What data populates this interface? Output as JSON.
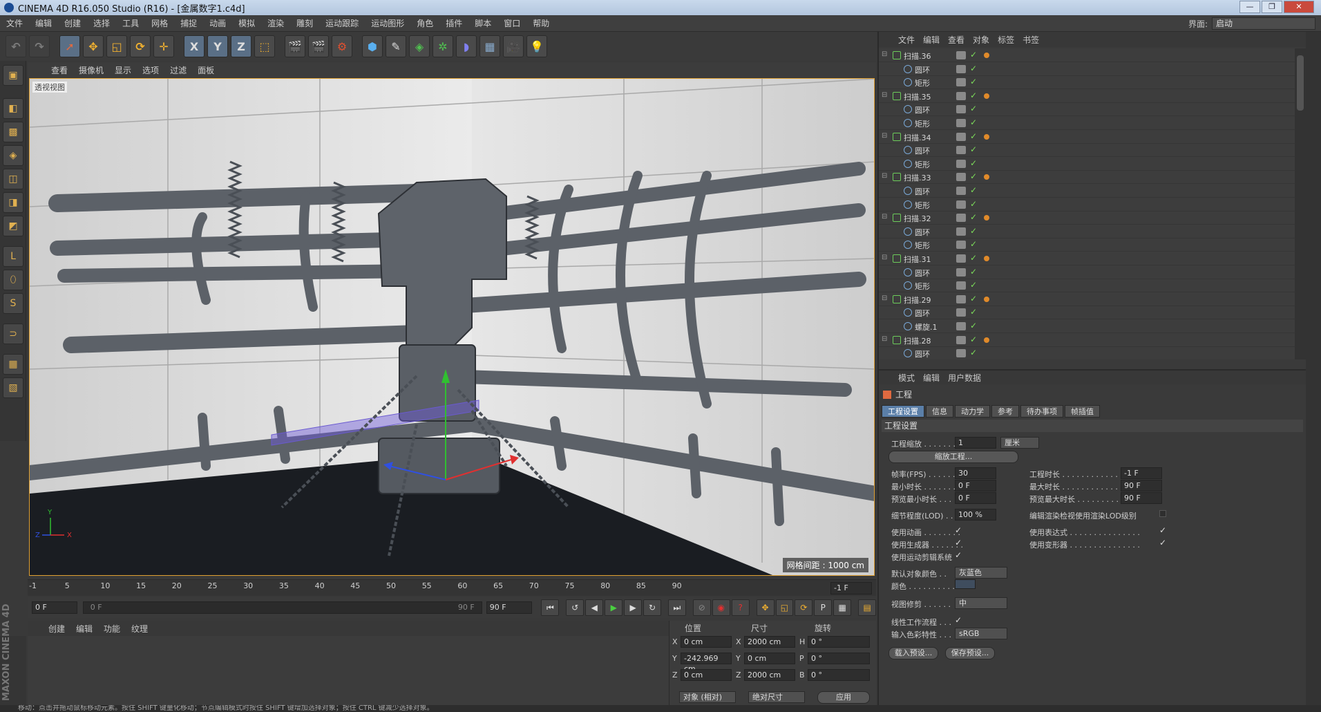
{
  "window": {
    "title": "CINEMA 4D R16.050 Studio (R16) - [金属数字1.c4d]"
  },
  "menubar": {
    "items": [
      "文件",
      "编辑",
      "创建",
      "选择",
      "工具",
      "网格",
      "捕捉",
      "动画",
      "模拟",
      "渲染",
      "雕刻",
      "运动跟踪",
      "运动图形",
      "角色",
      "插件",
      "脚本",
      "窗口",
      "帮助"
    ],
    "layout_label": "界面:",
    "layout_value": "启动"
  },
  "toolbar": {
    "axis_labels": [
      "X",
      "Y",
      "Z"
    ]
  },
  "viewport": {
    "menu": [
      "查看",
      "摄像机",
      "显示",
      "选项",
      "过滤",
      "面板"
    ],
    "camera_label": "透视视图",
    "grid_info": "网格间距 : 1000 cm",
    "axis_labels": {
      "x": "X",
      "y": "Y",
      "z": "Z"
    },
    "colors": {
      "pipe": "#5c6168",
      "wall": "#e6e6e6",
      "floor": "#1a1d22",
      "x_axis": "#e03030",
      "y_axis": "#30c030",
      "z_axis": "#3050e0"
    }
  },
  "timeline": {
    "ticks": [
      "-1",
      "5",
      "10",
      "15",
      "20",
      "25",
      "30",
      "35",
      "40",
      "45",
      "50",
      "55",
      "60",
      "65",
      "70",
      "75",
      "80",
      "85",
      "90"
    ],
    "current_frame": "-1 F"
  },
  "playback": {
    "start_field": "0 F",
    "slider_start": "0 F",
    "slider_end": "90 F",
    "end_field": "90 F"
  },
  "material_panel": {
    "menu": [
      "创建",
      "编辑",
      "功能",
      "纹理"
    ]
  },
  "brand": {
    "text": "MAXON CINEMA 4D"
  },
  "coords": {
    "headers": [
      "位置",
      "尺寸",
      "旋转"
    ],
    "rows": [
      {
        "axis": "X",
        "pos": "0 cm",
        "size_axis": "X",
        "size": "2000 cm",
        "rot_axis": "H",
        "rot": "0 °"
      },
      {
        "axis": "Y",
        "pos": "-242.969 cm",
        "size_axis": "Y",
        "size": "0 cm",
        "rot_axis": "P",
        "rot": "0 °"
      },
      {
        "axis": "Z",
        "pos": "0 cm",
        "size_axis": "Z",
        "size": "2000 cm",
        "rot_axis": "B",
        "rot": "0 °"
      }
    ],
    "mode_dropdown": "对象 (相对)",
    "size_dropdown": "绝对尺寸",
    "apply_button": "应用"
  },
  "object_manager": {
    "menu": [
      "文件",
      "编辑",
      "查看",
      "对象",
      "标签",
      "书签"
    ],
    "rows": [
      {
        "name": "扫描.36",
        "level": 0,
        "icon": "sweep-icon"
      },
      {
        "name": "圆环",
        "level": 1,
        "icon": "circle-icon"
      },
      {
        "name": "矩形",
        "level": 1,
        "icon": "rectangle-spline-icon"
      },
      {
        "name": "扫描.35",
        "level": 0,
        "icon": "sweep-icon"
      },
      {
        "name": "圆环",
        "level": 1,
        "icon": "circle-icon"
      },
      {
        "name": "矩形",
        "level": 1,
        "icon": "rectangle-spline-icon"
      },
      {
        "name": "扫描.34",
        "level": 0,
        "icon": "sweep-icon"
      },
      {
        "name": "圆环",
        "level": 1,
        "icon": "circle-icon"
      },
      {
        "name": "矩形",
        "level": 1,
        "icon": "rectangle-spline-icon"
      },
      {
        "name": "扫描.33",
        "level": 0,
        "icon": "sweep-icon"
      },
      {
        "name": "圆环",
        "level": 1,
        "icon": "circle-icon"
      },
      {
        "name": "矩形",
        "level": 1,
        "icon": "rectangle-spline-icon"
      },
      {
        "name": "扫描.32",
        "level": 0,
        "icon": "sweep-icon"
      },
      {
        "name": "圆环",
        "level": 1,
        "icon": "circle-icon"
      },
      {
        "name": "矩形",
        "level": 1,
        "icon": "rectangle-spline-icon"
      },
      {
        "name": "扫描.31",
        "level": 0,
        "icon": "sweep-icon"
      },
      {
        "name": "圆环",
        "level": 1,
        "icon": "circle-icon"
      },
      {
        "name": "矩形",
        "level": 1,
        "icon": "rectangle-spline-icon"
      },
      {
        "name": "扫描.29",
        "level": 0,
        "icon": "sweep-icon"
      },
      {
        "name": "圆环",
        "level": 1,
        "icon": "circle-icon"
      },
      {
        "name": "螺旋.1",
        "level": 1,
        "icon": "helix-icon"
      },
      {
        "name": "扫描.28",
        "level": 0,
        "icon": "sweep-icon"
      },
      {
        "name": "圆环",
        "level": 1,
        "icon": "circle-icon"
      }
    ]
  },
  "attributes": {
    "menu": [
      "模式",
      "编辑",
      "用户数据"
    ],
    "title": "工程",
    "tabs": [
      "工程设置",
      "信息",
      "动力学",
      "参考",
      "待办事项",
      "帧插值"
    ],
    "active_tab": "工程设置",
    "section": "工程设置",
    "scale_label": "工程缩放 . . . . . . .",
    "scale_value": "1",
    "scale_unit": "厘米",
    "scale_button": "缩放工程...",
    "fps_label": "帧率(FPS) . . . . . .",
    "fps_value": "30",
    "min_time_label": "最小时长 . . . . . . . .",
    "min_time_value": "0 F",
    "preview_min_label": "预览最小时长 . . .",
    "preview_min_value": "0 F",
    "project_time_label": "工程时长 . . . . . . . . . . . . . . .",
    "project_time_value": "-1 F",
    "max_time_label": "最大时长 . . . . . . . . . . . . . . .",
    "max_time_value": "90 F",
    "preview_max_label": "预览最大时长 . . . . . . . . . . .",
    "preview_max_value": "90 F",
    "lod_label": "细节程度(LOD) . .",
    "lod_value": "100 %",
    "render_lod_label": "编辑渲染检视使用渲染LOD级别",
    "use_anim_label": "使用动画 . . . . . . . .",
    "use_expr_label": "使用表达式 . . . . . . . . . . . . . . .",
    "use_gen_label": "使用生成器 . . . . . . .",
    "use_deform_label": "使用变形器 . . . . . . . . . . . . . . .",
    "use_motion_label": "使用运动剪辑系统",
    "default_color_label": "默认对象颜色 . .",
    "default_color_value": "灰蓝色",
    "color_label": "颜色 . . . . . . . . . .",
    "view_clip_label": "视图修剪 . . . . . .",
    "view_clip_value": "中",
    "linear_wf_label": "线性工作流程 . . .",
    "input_profile_label": "输入色彩特性 . . .",
    "input_profile_value": "sRGB",
    "load_preset": "载入预设...",
    "save_preset": "保存预设...",
    "check_mark": "✓",
    "swatch_color": "#3f4d5e"
  },
  "status": {
    "text": "移动：点击并拖动鼠标移动元素。按住 SHIFT 键量化移动；节点编辑模式时按住 SHIFT 键增加选择对象；按住 CTRL 键减少选择对象。"
  }
}
